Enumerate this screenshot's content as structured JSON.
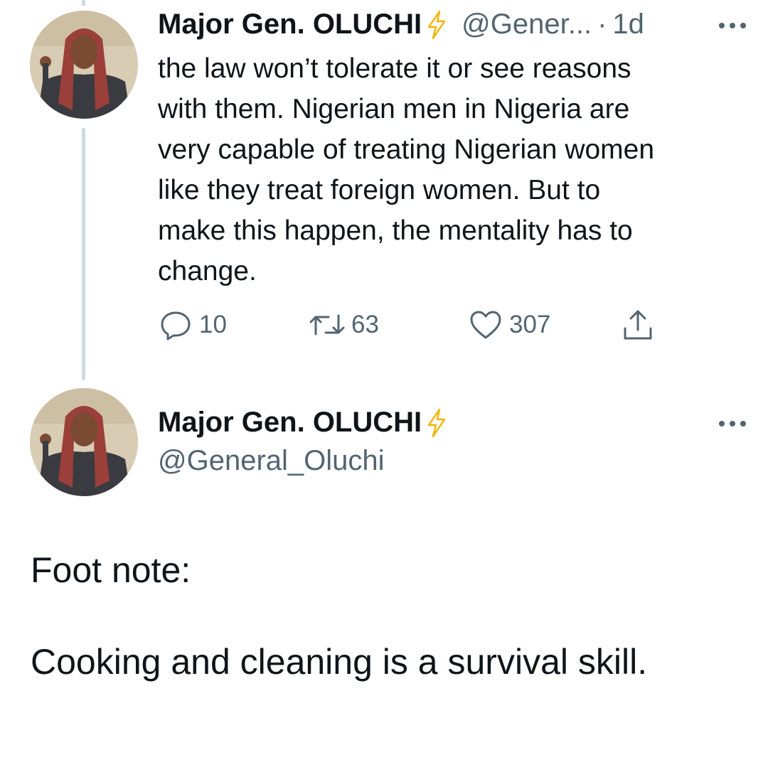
{
  "tweet1": {
    "display_name": "Major Gen. OLUCHI",
    "handle_truncated": "@Gener...",
    "separator": "·",
    "time": "1d",
    "text": "the law won’t tolerate it or see reasons\nwith them. Nigerian men in Nigeria are\nvery capable of treating Nigerian women\nlike they treat foreign women. But to\nmake this happen, the mentality has to\nchange.",
    "replies": "10",
    "retweets": "63",
    "likes": "307"
  },
  "tweet2": {
    "display_name": "Major Gen. OLUCHI",
    "handle": "@General_Oluchi",
    "foot_note": "Foot note:",
    "text": "Cooking and cleaning is a survival skill."
  },
  "icons": {
    "verified": "lightning-bolt-icon",
    "more": "more-options-icon",
    "reply": "reply-icon",
    "retweet": "retweet-icon",
    "like": "heart-icon",
    "share": "share-icon"
  },
  "colors": {
    "text_primary": "#0f1419",
    "text_secondary": "#536471",
    "thread_line": "#cfd9de",
    "bolt": "#f4b400"
  }
}
